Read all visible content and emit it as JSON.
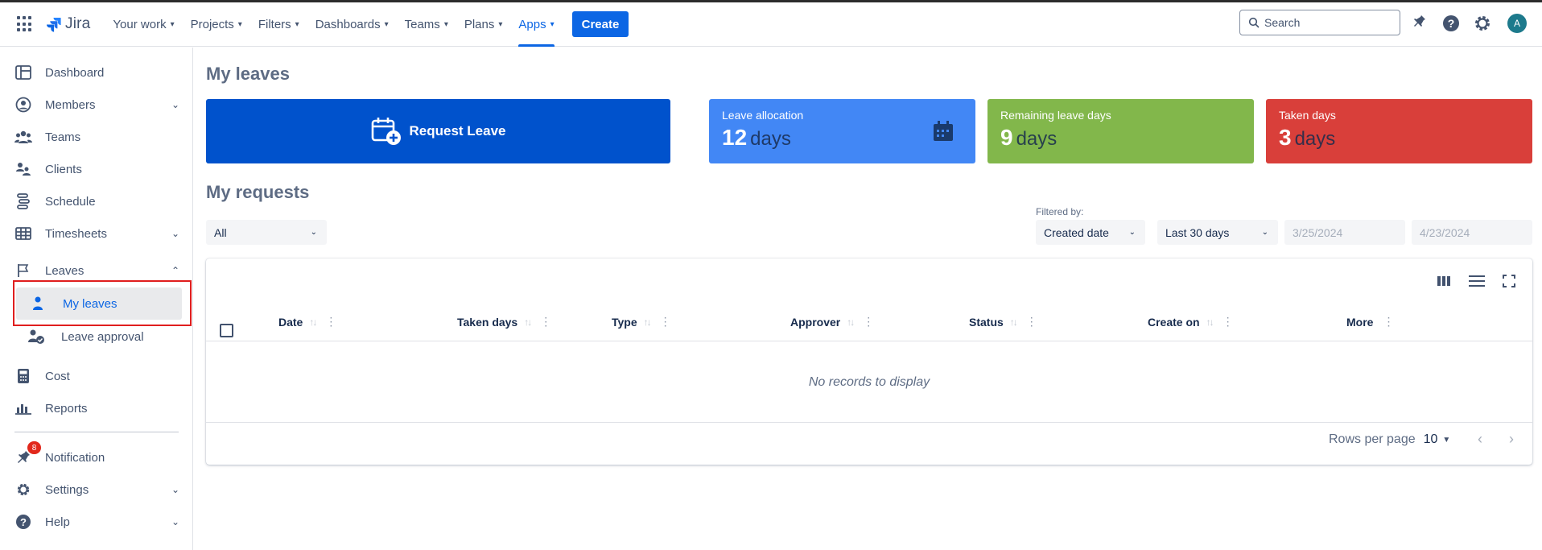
{
  "topnav": {
    "logo": "Jira",
    "items": [
      {
        "label": "Your work"
      },
      {
        "label": "Projects"
      },
      {
        "label": "Filters"
      },
      {
        "label": "Dashboards"
      },
      {
        "label": "Teams"
      },
      {
        "label": "Plans"
      },
      {
        "label": "Apps"
      }
    ],
    "active_item": "Apps",
    "create_label": "Create",
    "search_placeholder": "Search",
    "avatar_initial": "A"
  },
  "sidebar": {
    "items": [
      {
        "label": "Dashboard",
        "icon": "dashboard-icon"
      },
      {
        "label": "Members",
        "icon": "person-circle-icon",
        "expandable": true
      },
      {
        "label": "Teams",
        "icon": "people-icon"
      },
      {
        "label": "Clients",
        "icon": "clients-icon"
      },
      {
        "label": "Schedule",
        "icon": "schedule-icon"
      },
      {
        "label": "Timesheets",
        "icon": "table-icon",
        "expandable": true
      },
      {
        "label": "Leaves",
        "icon": "flag-icon",
        "expanded": true
      },
      {
        "label": "Cost",
        "icon": "calculator-icon"
      },
      {
        "label": "Reports",
        "icon": "bar-chart-icon"
      },
      {
        "label": "Notification",
        "icon": "megaphone-icon",
        "badge": "8"
      },
      {
        "label": "Settings",
        "icon": "gear-icon",
        "expandable": true
      },
      {
        "label": "Help",
        "icon": "question-icon",
        "expandable": true
      }
    ],
    "sub_items": [
      {
        "label": "My leaves",
        "icon": "person-icon",
        "active": true
      },
      {
        "label": "Leave approval",
        "icon": "person-check-icon"
      }
    ]
  },
  "main": {
    "title": "My leaves",
    "request_button": "Request Leave",
    "stats": [
      {
        "label": "Leave allocation",
        "value": "12",
        "unit": "days",
        "color": "#4287f5"
      },
      {
        "label": "Remaining leave days",
        "value": "9",
        "unit": "days",
        "color": "#82b74b"
      },
      {
        "label": "Taken days",
        "value": "3",
        "unit": "days",
        "color": "#d93f3a"
      }
    ],
    "requests_title": "My requests",
    "status_filter": "All",
    "filtered_by_label": "Filtered by:",
    "date_field": "Created date",
    "date_range": "Last 30 days",
    "date_from": "3/25/2024",
    "date_to": "4/23/2024"
  },
  "table": {
    "columns": [
      "Date",
      "Taken days",
      "Type",
      "Approver",
      "Status",
      "Create on",
      "More"
    ],
    "empty_text": "No records to display",
    "rows_per_page_label": "Rows per page",
    "rows_per_page_value": "10"
  }
}
